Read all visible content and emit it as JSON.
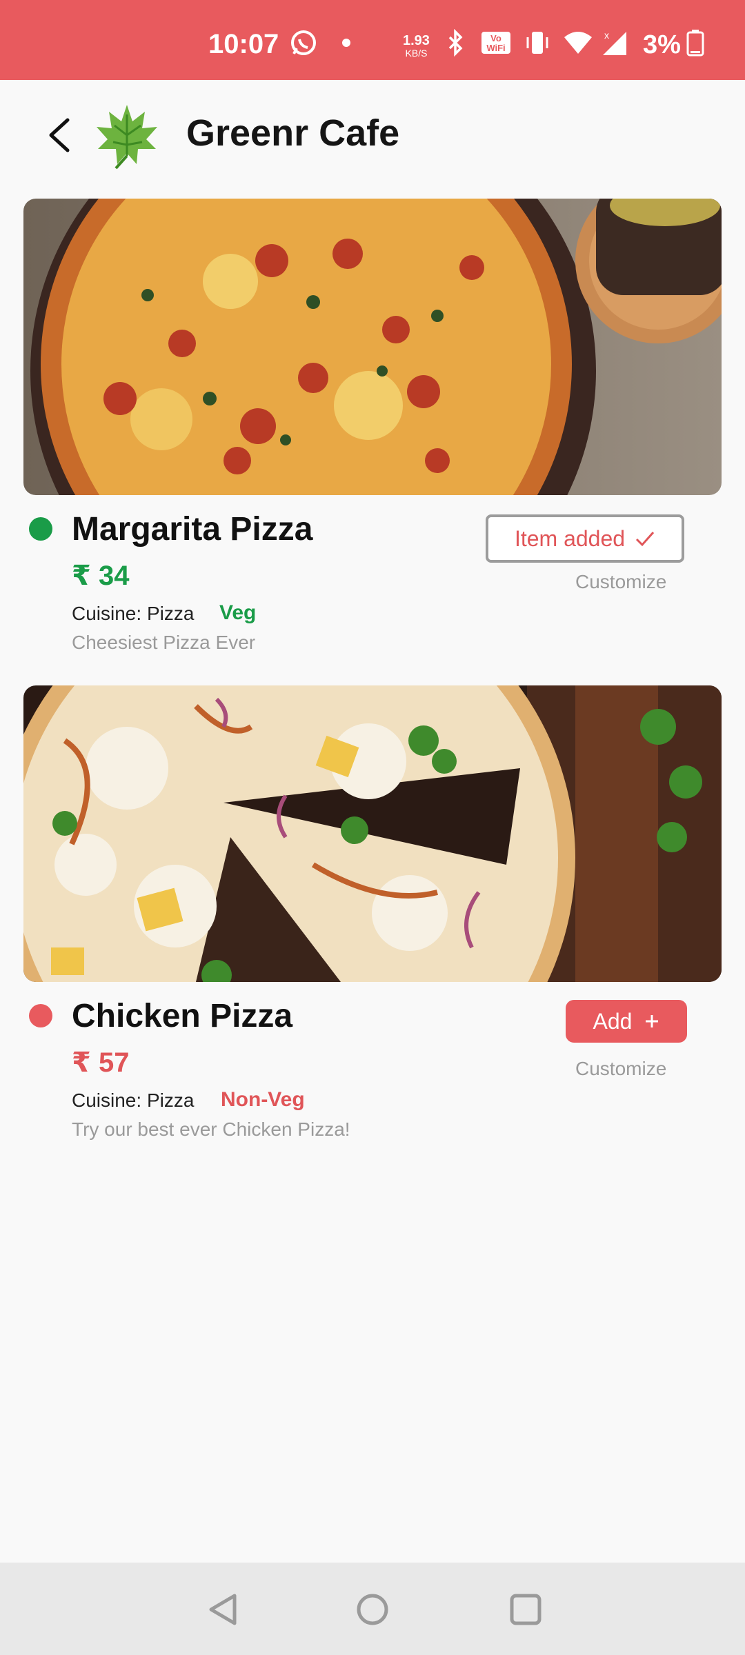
{
  "status_bar": {
    "time": "10:07",
    "net_speed": "1.93",
    "net_unit": "KB/S",
    "battery": "3%",
    "icons": [
      "whatsapp-icon",
      "dot-icon",
      "bluetooth-icon",
      "volte-wifi-icon",
      "vibrate-icon",
      "wifi-icon",
      "signal-icon",
      "battery-icon"
    ]
  },
  "header": {
    "title": "Greenr Cafe",
    "back_icon": "chevron-left-icon",
    "logo_icon": "leaf-logo"
  },
  "items": [
    {
      "name": "Margarita Pizza",
      "price": "₹ 34",
      "cuisine": "Cuisine: Pizza",
      "type": "Veg",
      "description": "Cheesiest Pizza Ever",
      "button": "Item added",
      "customize": "Customize",
      "type_color": "#1a9c48"
    },
    {
      "name": "Chicken Pizza",
      "price": "₹ 57",
      "cuisine": "Cuisine: Pizza",
      "type": "Non-Veg",
      "description": "Try our best ever Chicken Pizza!",
      "button": "Add",
      "customize": "Customize",
      "type_color": "#e05558"
    }
  ],
  "colors": {
    "accent": "#e85a5e",
    "veg": "#1a9c48",
    "nonveg": "#e05558"
  }
}
